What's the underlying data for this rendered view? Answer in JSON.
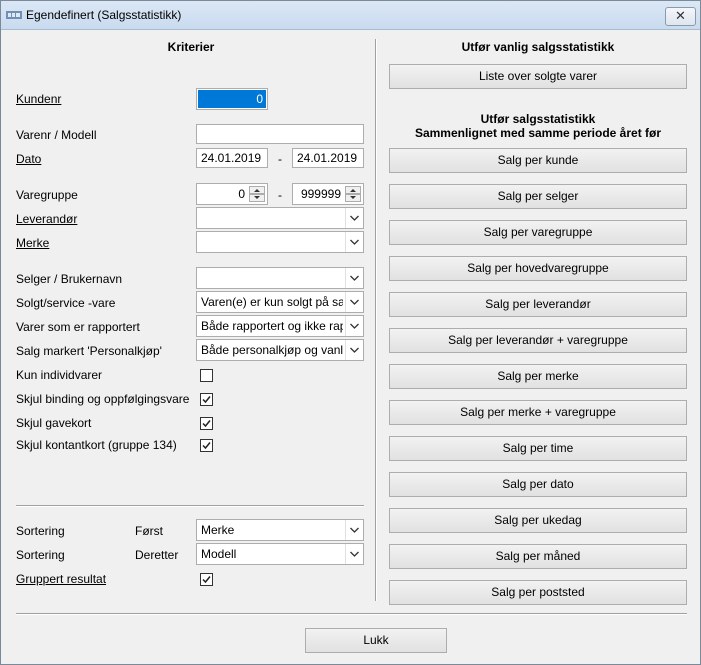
{
  "window": {
    "title": "Egendefinert (Salgsstatistikk)",
    "close_glyph": "✕"
  },
  "criteria": {
    "header": "Kriterier",
    "kundenr_label": "Kundenr",
    "kundenr_value": "0",
    "varenr_label": "Varenr / Modell",
    "varenr_value": "",
    "dato_label": "Dato",
    "dato_from": "24.01.2019",
    "dato_to": "24.01.2019",
    "range_sep": "-",
    "varegruppe_label": "Varegruppe",
    "varegruppe_from": "0",
    "varegruppe_to": "999999",
    "leverandor_label": "Leverandør",
    "leverandor_value": "",
    "merke_label": "Merke",
    "merke_value": "",
    "selger_label": "Selger / Brukernavn",
    "selger_value": "",
    "solgt_label": "Solgt/service -vare",
    "solgt_value": "Varen(e) er kun solgt på salg",
    "rapportert_label": "Varer som er rapportert",
    "rapportert_value": "Både rapportert og ikke rapportert",
    "personalkjop_label": "Salg markert 'Personalkjøp'",
    "personalkjop_value": "Både personalkjøp og vanlige salg",
    "individ_label": "Kun individvarer",
    "individ_checked": false,
    "binding_label": "Skjul binding og oppfølgingsvare",
    "binding_checked": true,
    "gavekort_label": "Skjul gavekort",
    "gavekort_checked": true,
    "kontantkort_label": "Skjul kontantkort (gruppe 134)",
    "kontantkort_checked": true,
    "sortering1_label": "Sortering",
    "forst_label": "Først",
    "sortering1_value": "Merke",
    "sortering2_label": "Sortering",
    "deretter_label": "Deretter",
    "sortering2_value": "Modell",
    "gruppert_label": "Gruppert resultat",
    "gruppert_checked": true
  },
  "right": {
    "header1": "Utfør vanlig salgsstatistikk",
    "liste_button": "Liste over solgte varer",
    "header2_line1": "Utfør salgsstatistikk",
    "header2_line2": "Sammenlignet med samme periode året før",
    "buttons": [
      "Salg per kunde",
      "Salg per selger",
      "Salg per varegruppe",
      "Salg per hovedvaregruppe",
      "Salg per leverandør",
      "Salg per leverandør + varegruppe",
      "Salg per merke",
      "Salg per merke + varegruppe",
      "Salg per time",
      "Salg per dato",
      "Salg per ukedag",
      "Salg per måned",
      "Salg per poststed"
    ]
  },
  "footer": {
    "lukk_button": "Lukk"
  }
}
